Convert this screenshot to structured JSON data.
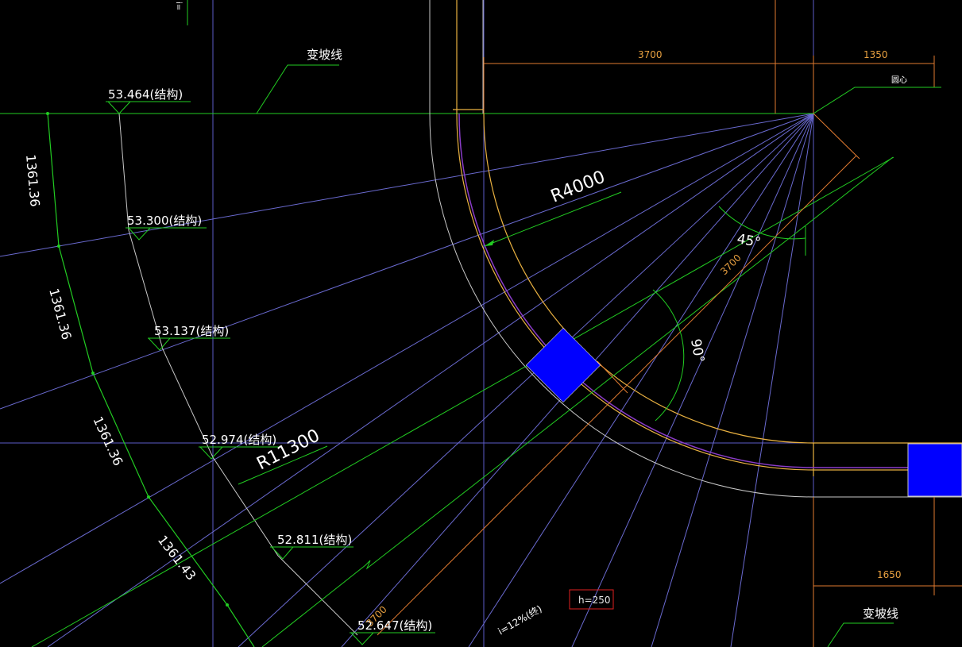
{
  "colors": {
    "background": "#000000",
    "grid_axis": "#5c5cc8",
    "radial": "#6a6ad0",
    "green": "#22cc22",
    "yellow": "#e8b040",
    "orange": "#e07a30",
    "white": "#d8d8d8",
    "purple": "#8a3cc8",
    "blue_block": "#0000ff",
    "red_box": "#e02020"
  },
  "labels": {
    "slope_change_top": "变坡线",
    "slope_change_bottom": "变坡线",
    "elev_1": "53.464(结构)",
    "elev_2": "53.300(结构)",
    "elev_3": "53.137(结构)",
    "elev_4": "52.974(结构)",
    "elev_5": "52.811(结构)",
    "elev_6": "52.647(结构)",
    "arc_len_1": "1361.36",
    "arc_len_2": "1361.36",
    "arc_len_3": "1361.36",
    "arc_len_4": "1361.43",
    "radius_inner": "R4000",
    "radius_outer": "R11300",
    "angle_45": "45°",
    "angle_90": "90°",
    "dim_3700_top": "3700",
    "dim_1350": "1350",
    "dim_3700_diag": "3700",
    "dim_1650": "1650",
    "center_label": "圆心",
    "thickness": "h=250",
    "slope_note": "i=12%(终)",
    "top_left_text": "i=",
    "dim_3700_bottom": "3700"
  }
}
